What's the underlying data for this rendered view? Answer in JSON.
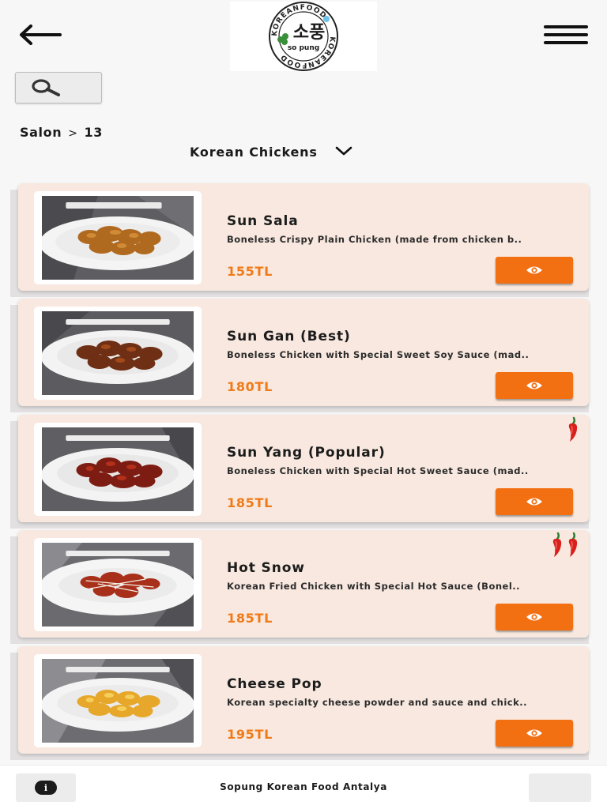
{
  "header": {
    "back_icon": "arrow-left-icon",
    "logo": {
      "ring_text": "KOREANFOOD",
      "korean_text": "소풍",
      "brand_text": "so pung"
    },
    "menu_icon": "hamburger-icon"
  },
  "search": {
    "icon": "search-icon"
  },
  "breadcrumb": {
    "parent": "Salon",
    "separator": ">",
    "current": "13"
  },
  "category": {
    "selected": "Korean Chickens",
    "icon": "chevron-down-icon"
  },
  "colors": {
    "accent": "#f26f12",
    "price": "#f07a17",
    "card_bg": "#f8e8df",
    "pepper": "#d8201c"
  },
  "items": [
    {
      "name": "Sun Sala",
      "description": "Boneless Crispy Plain Chicken (made from chicken b..",
      "price": "155TL",
      "spice_level": 0,
      "view_icon": "eye-icon"
    },
    {
      "name": "Sun Gan (Best)",
      "description": "Boneless Chicken with Special Sweet Soy Sauce (mad..",
      "price": "180TL",
      "spice_level": 0,
      "view_icon": "eye-icon"
    },
    {
      "name": "Sun Yang (Popular)",
      "description": "Boneless Chicken with Special Hot Sweet Sauce (mad..",
      "price": "185TL",
      "spice_level": 1,
      "view_icon": "eye-icon"
    },
    {
      "name": "Hot Snow",
      "description": "Korean Fried Chicken with Special Hot Sauce (Bonel..",
      "price": "185TL",
      "spice_level": 2,
      "view_icon": "eye-icon"
    },
    {
      "name": "Cheese Pop",
      "description": "Korean specialty cheese powder and sauce and chick..",
      "price": "195TL",
      "spice_level": 0,
      "view_icon": "eye-icon"
    }
  ],
  "footer": {
    "info_icon": "info-icon",
    "info_symbol": "i",
    "title": "Sopung Korean Food Antalya"
  }
}
